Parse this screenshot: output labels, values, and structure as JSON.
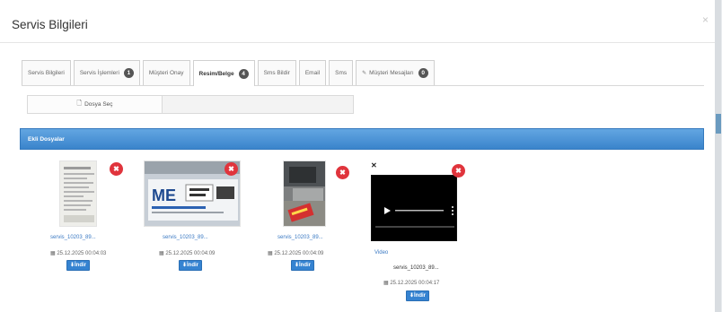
{
  "modal": {
    "title": "Servis Bilgileri",
    "close_icon": "×"
  },
  "tabs": [
    {
      "label": "Servis Bilgileri",
      "badge": null,
      "icon": null,
      "active": false
    },
    {
      "label": "Servis İşlemleri",
      "badge": "1",
      "icon": null,
      "active": false
    },
    {
      "label": "Müşteri Onay",
      "badge": null,
      "icon": null,
      "active": false
    },
    {
      "label": "Resim/Belge",
      "badge": "4",
      "icon": null,
      "active": true
    },
    {
      "label": "Sms Bildir",
      "badge": null,
      "icon": null,
      "active": false
    },
    {
      "label": "Email",
      "badge": null,
      "icon": null,
      "active": false
    },
    {
      "label": "Sms",
      "badge": null,
      "icon": "comments-icon",
      "active": false
    },
    {
      "label": "Müşteri Mesajları",
      "badge": "0",
      "icon": "comments-icon",
      "active": false
    }
  ],
  "upload": {
    "button_label": "Dosya Seç",
    "file_name": ""
  },
  "attachments_section": {
    "title": "Ekli Dosyalar"
  },
  "attachments": [
    {
      "name": "servis_10203_89...",
      "date": "25.12.2025 00:04:03",
      "download_label": "İndir",
      "type": "document"
    },
    {
      "name": "servis_10203_89...",
      "date": "25.12.2025 00:04:09",
      "download_label": "İndir",
      "type": "label-photo"
    },
    {
      "name": "servis_10203_89...",
      "date": "25.12.2025 00:04:09",
      "download_label": "İndir",
      "type": "device-photo"
    },
    {
      "name": "servis_10203_89...",
      "link_label": "Video",
      "date": "25.12.2025 00:04:17",
      "download_label": "İndir",
      "type": "video"
    }
  ],
  "colors": {
    "accent_blue": "#3a84cb",
    "delete_red": "#e0343c",
    "badge_dark": "#555555"
  },
  "icons": {
    "calendar": "calendar-icon",
    "download": "download-icon",
    "delete": "remove-icon",
    "file": "file-icon",
    "play": "play-icon"
  }
}
